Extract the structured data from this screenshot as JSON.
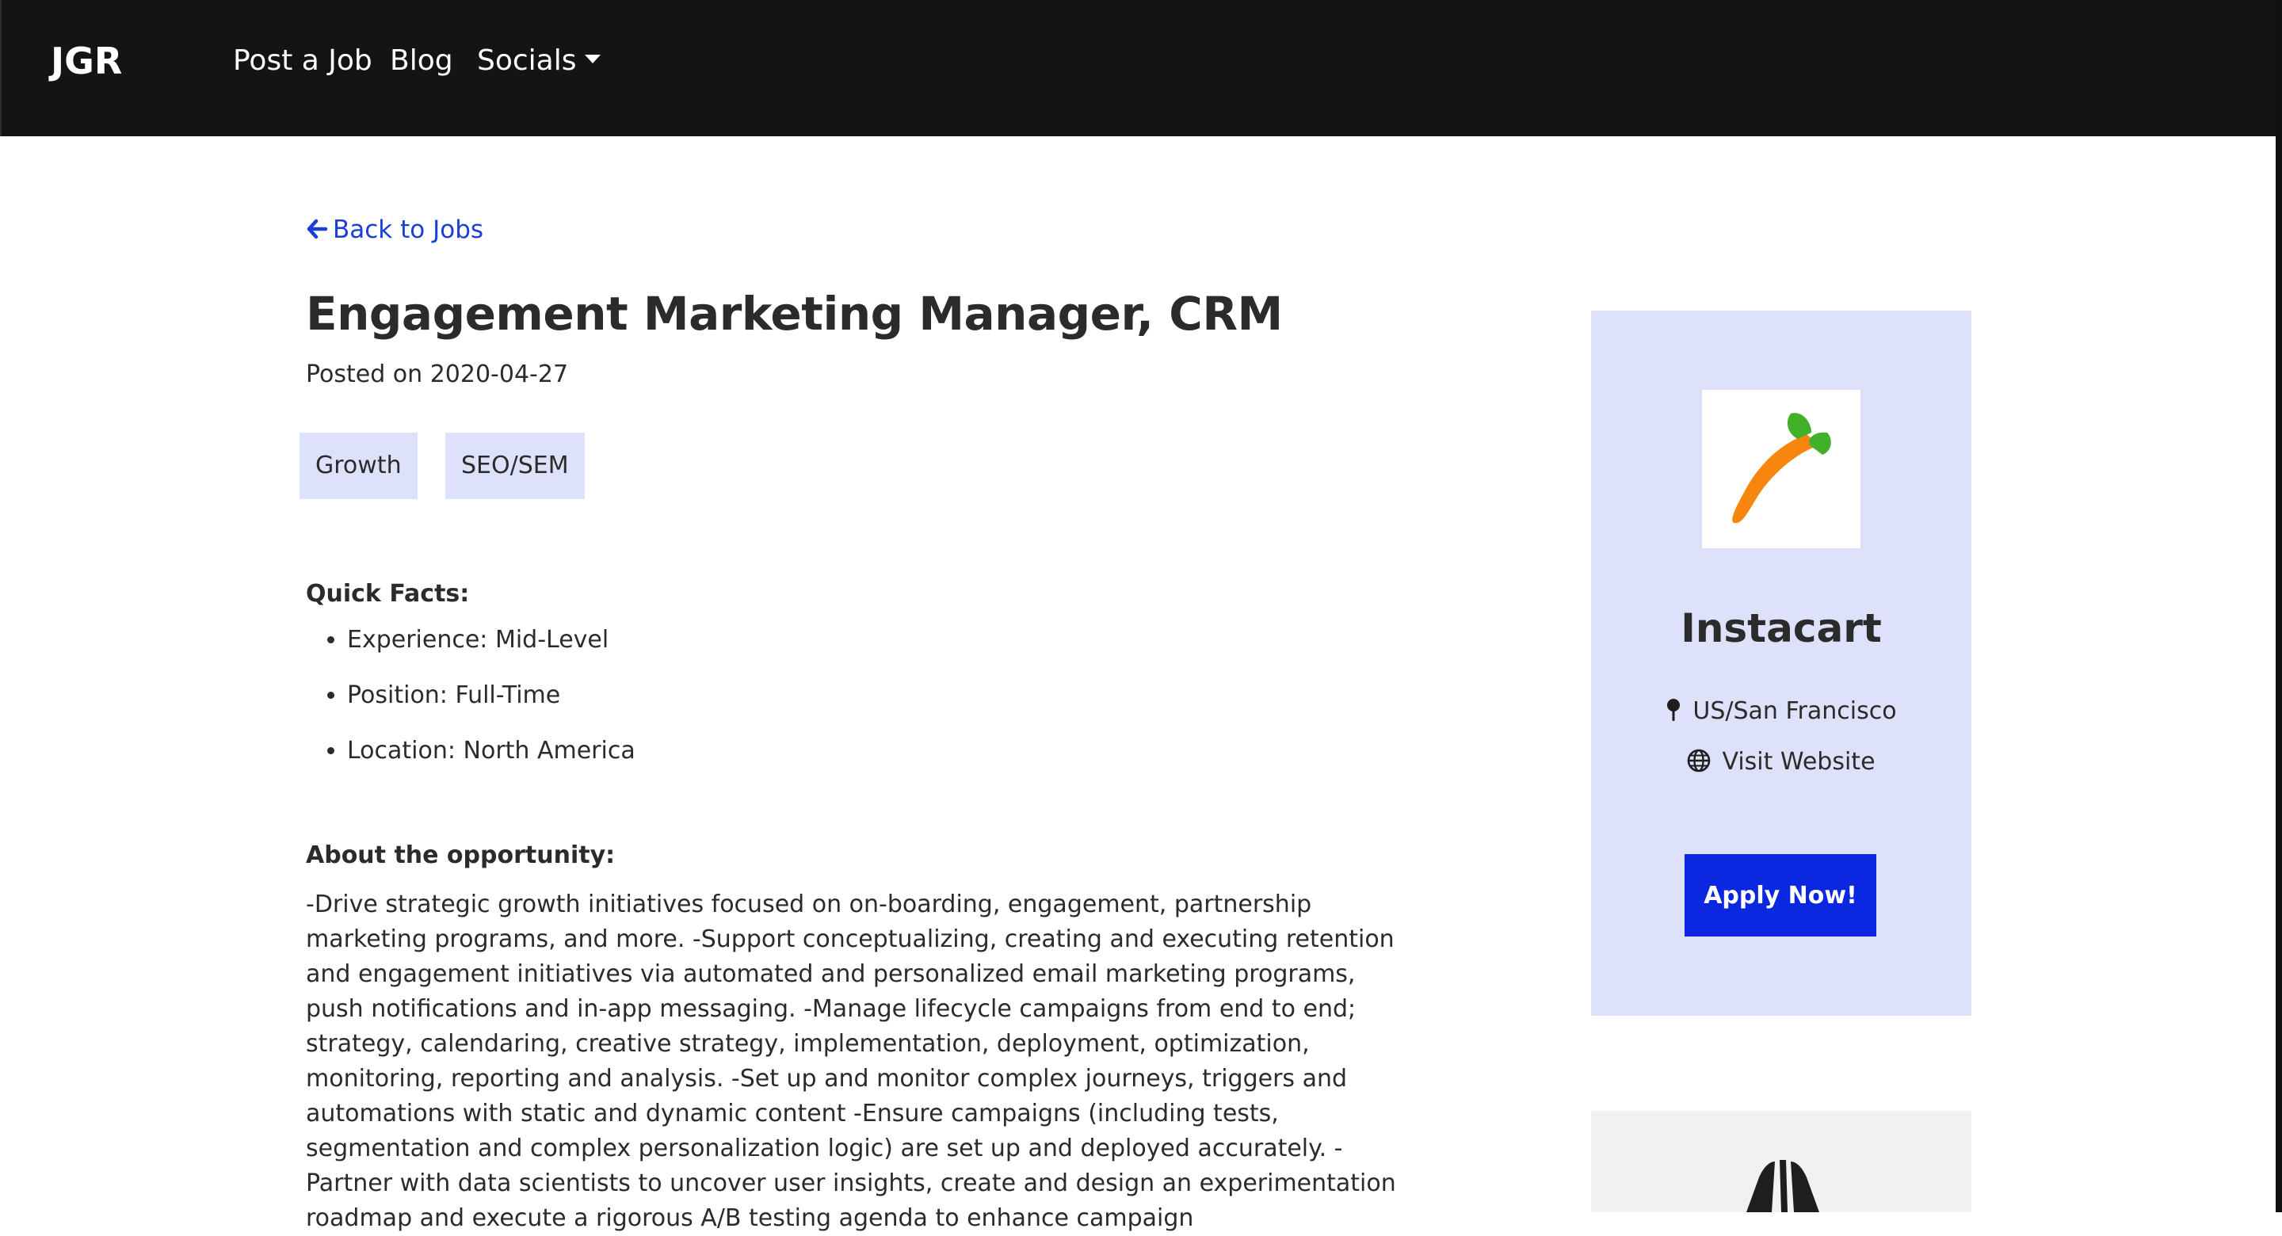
{
  "navbar": {
    "brand": "JGR",
    "links": [
      {
        "label": "Post a Job"
      },
      {
        "label": "Blog"
      },
      {
        "label": "Socials"
      }
    ]
  },
  "job": {
    "back_label": "Back to Jobs",
    "title": "Engagement Marketing Manager, CRM",
    "posted": "Posted on 2020-04-27",
    "tags": [
      "Growth",
      "SEO/SEM"
    ],
    "quick_facts_label": "Quick Facts:",
    "quick_facts": [
      "Experience: Mid-Level",
      "Position: Full-Time",
      "Location: North America"
    ],
    "about_label": "About the opportunity:",
    "about_text": "-Drive strategic growth initiatives focused on on-boarding, engagement, partnership marketing programs, and more. -Support conceptualizing, creating and executing retention and engagement initiatives via automated and personalized email marketing programs, push notifications and in-app messaging. -Manage lifecycle campaigns from end to end; strategy, calendaring, creative strategy, implementation, deployment, optimization, monitoring, reporting and analysis. -Set up and monitor complex journeys, triggers and automations with static and dynamic content -Ensure campaigns (including tests, segmentation and complex personalization logic) are set up and deployed accurately. -Partner with data scientists to uncover user insights, create and design an experimentation roadmap and execute a rigorous A/B testing agenda to enhance campaign"
  },
  "company": {
    "name": "Instacart",
    "location": "US/San Francisco",
    "website_label": "Visit Website",
    "apply_label": "Apply Now!",
    "logo_icon": "carrot-icon"
  },
  "colors": {
    "navbar_bg": "#131416",
    "card_bg": "#dde1f9",
    "link": "#1b3fd6",
    "button": "#0b28e0",
    "carrot_orange": "#f7860f",
    "carrot_green": "#43b02a"
  }
}
